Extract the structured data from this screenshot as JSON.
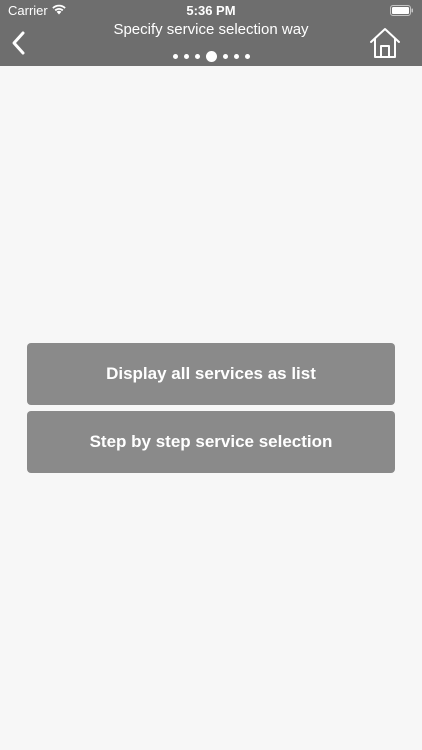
{
  "status_bar": {
    "carrier": "Carrier",
    "time": "5:36 PM"
  },
  "header": {
    "title": "Specify service selection way",
    "progress": {
      "total_steps": 7,
      "current_step": 4
    }
  },
  "options": [
    {
      "label": "Display all services as list"
    },
    {
      "label": "Step by step service selection"
    }
  ],
  "colors": {
    "header_bg": "#6e6e6e",
    "button_bg": "#8a8a8a",
    "page_bg": "#f7f7f7"
  },
  "icons": [
    "wifi-icon",
    "battery-icon",
    "back-arrow-icon",
    "home-icon"
  ]
}
